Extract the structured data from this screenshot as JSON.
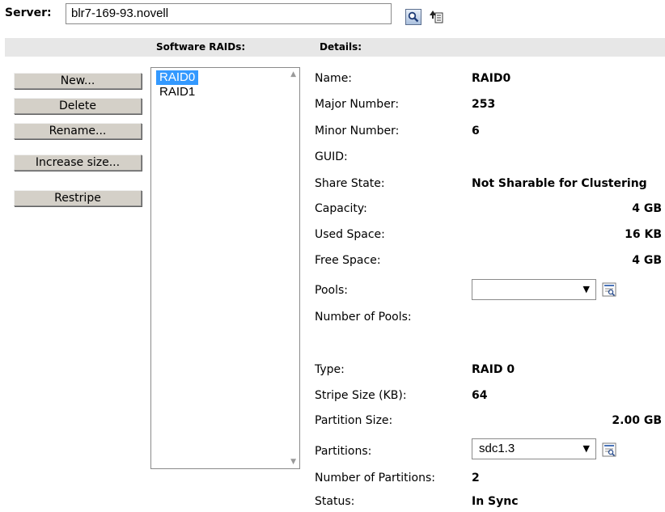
{
  "server": {
    "label": "Server:",
    "value": "blr7-169-93.novell"
  },
  "icons": {
    "search": "search-icon",
    "tree": "tree-browse-icon",
    "properties": "properties-icon"
  },
  "headers": {
    "software_raids": "Software RAIDs:",
    "details": "Details:"
  },
  "actions": {
    "new": "New...",
    "delete": "Delete",
    "rename": "Rename...",
    "increase_size": "Increase size...",
    "restripe": "Restripe"
  },
  "raids": [
    {
      "name": "RAID0",
      "selected": true
    },
    {
      "name": "RAID1",
      "selected": false
    }
  ],
  "details": {
    "name_label": "Name:",
    "name_value": "RAID0",
    "major_label": "Major Number:",
    "major_value": "253",
    "minor_label": "Minor Number:",
    "minor_value": "6",
    "guid_label": "GUID:",
    "share_label": "Share State:",
    "share_value": "Not Sharable for Clustering",
    "capacity_label": "Capacity:",
    "capacity_value": "4 GB",
    "used_label": "Used Space:",
    "used_value": "16 KB",
    "free_label": "Free Space:",
    "free_value": "4 GB",
    "pools_label": "Pools:",
    "pools_selected": "",
    "num_pools_label": "Number of Pools:",
    "type_label": "Type:",
    "type_value": "RAID 0",
    "stripe_label": "Stripe Size (KB):",
    "stripe_value": "64",
    "partition_size_label": "Partition Size:",
    "partition_size_value": "2.00 GB",
    "partitions_label": "Partitions:",
    "partitions_selected": "sdc1.3",
    "num_partitions_label": "Number of Partitions:",
    "num_partitions_value": "2",
    "status_label": "Status:",
    "status_value": "In Sync"
  },
  "colors": {
    "selection": "#3399ff",
    "header_strip": "#e7e7e7",
    "button_face": "#d4d0c8"
  }
}
